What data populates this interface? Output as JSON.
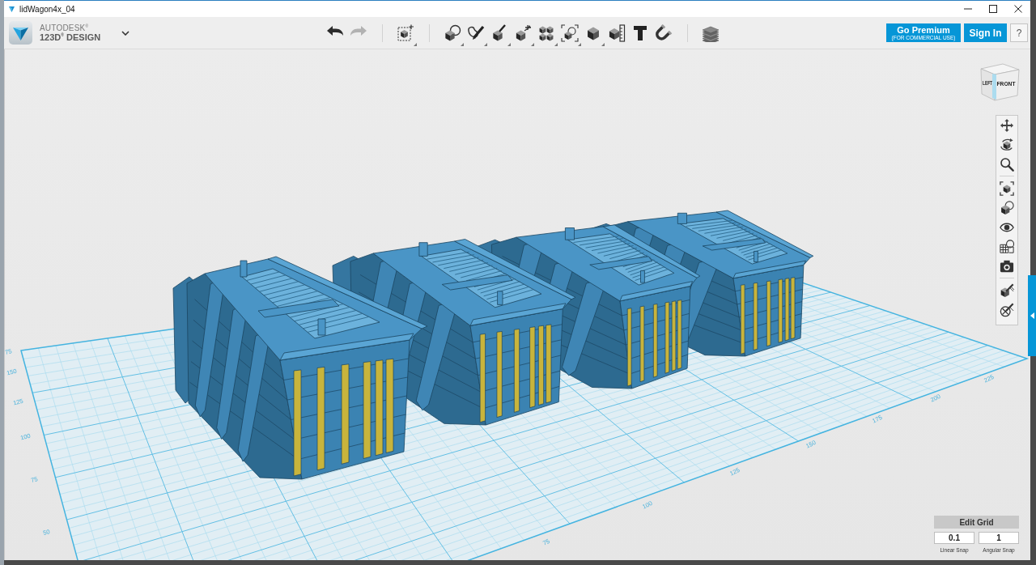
{
  "window": {
    "title": "lidWagon4x_04"
  },
  "header": {
    "brand": {
      "company": "AUTODESK$^{®}$",
      "product": "123D$^{®}$ DESIGN"
    },
    "toolbar_groups": [
      {
        "items": [
          {
            "kind": "undo",
            "disabled": false,
            "menu": false
          },
          {
            "kind": "redo",
            "disabled": true,
            "menu": false
          }
        ]
      },
      {
        "items": [
          {
            "kind": "transform",
            "disabled": false,
            "menu": true
          }
        ]
      },
      {
        "items": [
          {
            "kind": "primitives",
            "disabled": false,
            "menu": true
          },
          {
            "kind": "sketch",
            "disabled": false,
            "menu": true
          },
          {
            "kind": "construct",
            "disabled": false,
            "menu": true
          },
          {
            "kind": "modify",
            "disabled": false,
            "menu": true
          },
          {
            "kind": "pattern",
            "disabled": false,
            "menu": true
          },
          {
            "kind": "group",
            "disabled": false,
            "menu": true
          },
          {
            "kind": "combine",
            "disabled": false,
            "menu": true
          },
          {
            "kind": "measure",
            "disabled": false,
            "menu": false
          },
          {
            "kind": "text",
            "disabled": false,
            "menu": false
          },
          {
            "kind": "snap",
            "disabled": false,
            "menu": false
          }
        ]
      },
      {
        "items": [
          {
            "kind": "materials",
            "disabled": false,
            "menu": false
          }
        ]
      }
    ],
    "buttons": [
      {
        "kind": "premium",
        "label": "Go Premium",
        "note": "(FOR COMMERCIAL USE)"
      },
      {
        "kind": "sign_in",
        "label": "Sign In"
      },
      {
        "kind": "help",
        "label": "?"
      }
    ]
  },
  "viewport": {
    "view_cube": {
      "faces": [
        "LEFT",
        "FRONT"
      ]
    },
    "grid": {
      "left_labels": [
        "75",
        "150",
        "125",
        "100",
        "75",
        "50"
      ],
      "right_labels": [
        "225",
        "200",
        "175",
        "150",
        "125",
        "100",
        "75"
      ]
    },
    "nav_groups": [
      {
        "items": [
          {
            "kind": "pan"
          },
          {
            "kind": "orbit"
          },
          {
            "kind": "zoom"
          }
        ]
      },
      {
        "items": [
          {
            "kind": "fit"
          },
          {
            "kind": "views"
          },
          {
            "kind": "visibility"
          },
          {
            "kind": "materials"
          },
          {
            "kind": "camera"
          }
        ]
      },
      {
        "items": [
          {
            "kind": "paint"
          },
          {
            "kind": "paint_erase"
          }
        ]
      }
    ],
    "edit_grid": {
      "button": "Edit Grid",
      "fields": [
        {
          "label": "Linear Snap",
          "value": "0.1"
        },
        {
          "label": "Angular Snap",
          "value": "1"
        }
      ]
    }
  }
}
